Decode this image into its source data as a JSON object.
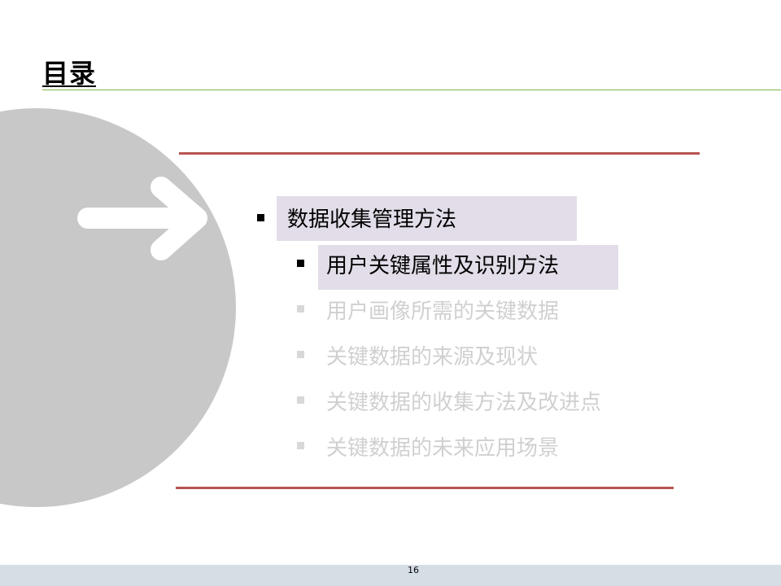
{
  "slide": {
    "title": "目录",
    "page_number": "16"
  },
  "agenda": {
    "level1": {
      "label": "数据收集管理方法",
      "state": "active"
    },
    "level2": [
      {
        "label": "用户关键属性及识别方法",
        "state": "active"
      },
      {
        "label": "用户画像所需的关键数据",
        "state": "inactive"
      },
      {
        "label": "关键数据的来源及现状",
        "state": "inactive"
      },
      {
        "label": "关键数据的收集方法及改进点",
        "state": "inactive"
      },
      {
        "label": "关键数据的未来应用场景",
        "state": "inactive"
      }
    ]
  },
  "colors": {
    "title_rule": "#7fb24a",
    "section_rules": "#b85450",
    "highlight": "#e2dde8",
    "circle": "#c8c8c8",
    "inactive_text": "#d0d0d0",
    "footer_bar": "#d5dde5"
  },
  "icons": {
    "arrow": "arrow-right-icon",
    "bullet": "square-bullet-icon"
  }
}
